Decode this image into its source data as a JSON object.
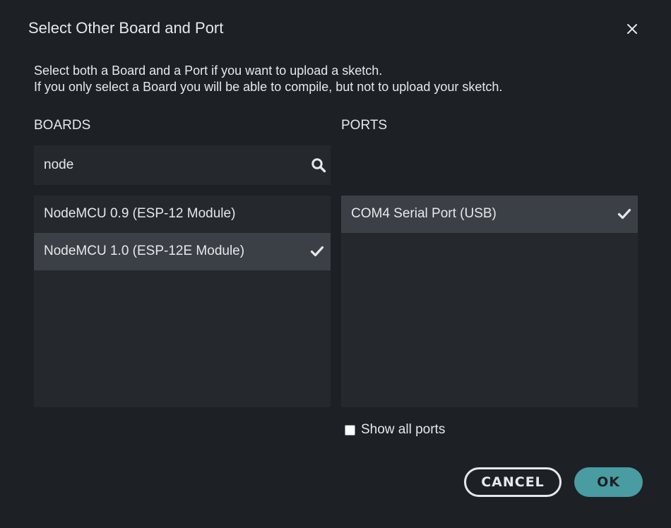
{
  "dialog": {
    "title": "Select Other Board and Port",
    "intro_line1": "Select both a Board and a Port if you want to upload a sketch.",
    "intro_line2": "If you only select a Board you will be able to compile, but not to upload your sketch."
  },
  "boards": {
    "heading": "BOARDS",
    "search_value": "node",
    "items": [
      {
        "label": "NodeMCU 0.9 (ESP-12 Module)",
        "selected": false
      },
      {
        "label": "NodeMCU 1.0 (ESP-12E Module)",
        "selected": true
      }
    ]
  },
  "ports": {
    "heading": "PORTS",
    "items": [
      {
        "label": "COM4 Serial Port (USB)",
        "selected": true
      }
    ],
    "show_all_label": "Show all ports",
    "show_all_checked": false
  },
  "buttons": {
    "cancel_label": "CANCEL",
    "ok_label": "OK"
  },
  "icons": {
    "close": "close-icon",
    "search": "search-icon",
    "check": "checkmark-icon"
  },
  "colors": {
    "background": "#1d2024",
    "panel": "#25292d",
    "selected_row": "#3b4046",
    "text": "#e6e8ea",
    "accent": "#4a9ca3"
  }
}
